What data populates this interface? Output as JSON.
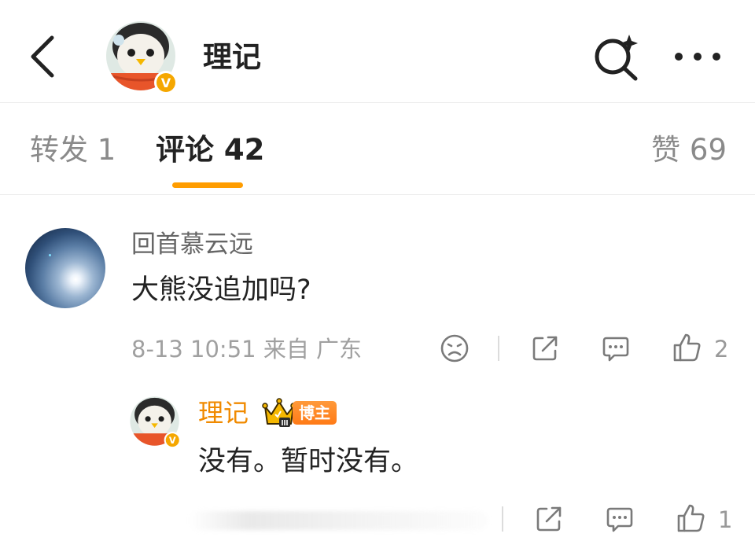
{
  "header": {
    "title": "理记",
    "back_icon": "chevron-left-icon",
    "search_icon": "search-sparkle-icon",
    "more_icon": "more-dots-icon"
  },
  "tabs": {
    "repost": "转发 1",
    "comment": "评论 42",
    "like": "赞 69",
    "active_color": "#ff9d00"
  },
  "comment": {
    "username": "回首慕云远",
    "text": "大熊没追加吗?",
    "meta": "8-13 10:51  来自 广东",
    "like_count": "2",
    "icons": [
      "sad-face-icon",
      "share-icon",
      "reply-icon",
      "thumbs-up-icon"
    ]
  },
  "reply": {
    "username": "理记",
    "badge": "博主",
    "text": "没有。暂时没有。",
    "like_count": "1",
    "name_color": "#f08a00",
    "icons": [
      "crown-icon",
      "share-icon",
      "reply-icon",
      "thumbs-up-icon"
    ]
  }
}
